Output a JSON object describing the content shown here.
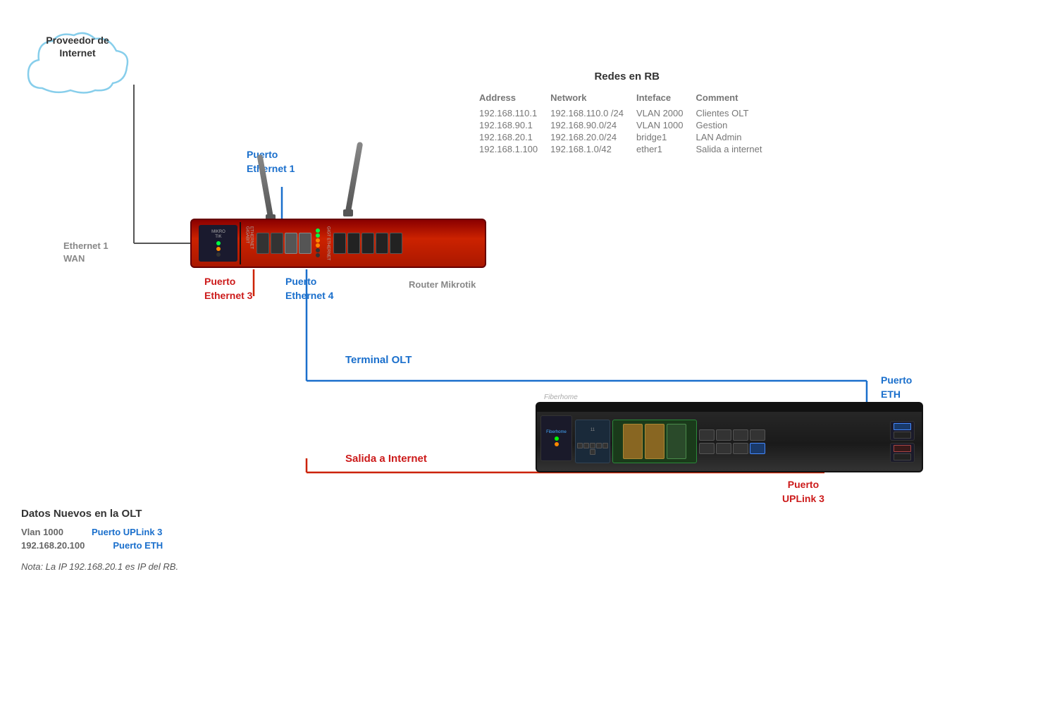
{
  "cloud": {
    "label_line1": "Proveedor de",
    "label_line2": "Internet"
  },
  "labels": {
    "ethernet1_wan": "Ethernet 1\nWAN",
    "puerto_eth1": "Puerto\nEthernet 1",
    "puerto_eth3": "Puerto\nEthernet 3",
    "puerto_eth4": "Puerto\nEthernet 4",
    "router_name": "Router Mikrotik",
    "terminal_olt": "Terminal OLT",
    "salida_internet": "Salida a Internet",
    "puerto_eth_olt": "Puerto\nETH",
    "puerto_uplink3": "Puerto\nUPLink 3"
  },
  "table": {
    "title": "Redes en RB",
    "headers": [
      "Address",
      "Network",
      "Inteface",
      "Comment"
    ],
    "rows": [
      [
        "192.168.110.1",
        "192.168.110.0 /24",
        "VLAN 2000",
        "Clientes OLT"
      ],
      [
        "192.168.90.1",
        "192.168.90.0/24",
        "VLAN 1000",
        "Gestion"
      ],
      [
        "192.168.20.1",
        "192.168.20.0/24",
        "bridge1",
        "LAN Admin"
      ],
      [
        "192.168.1.100",
        "192.168.1.0/42",
        "ether1",
        "Salida a internet"
      ]
    ]
  },
  "bottom": {
    "title": "Datos Nuevos en  la OLT",
    "rows": [
      {
        "left": "Vlan 1000",
        "right": "Puerto UPLink 3"
      },
      {
        "left": "192.168.20.100",
        "right": "Puerto ETH"
      }
    ],
    "note": "Nota: La IP 192.168.20.1 es IP del RB."
  },
  "colors": {
    "blue": "#1a6fcc",
    "red": "#cc1a1a",
    "dark": "#333",
    "gray": "#888"
  }
}
